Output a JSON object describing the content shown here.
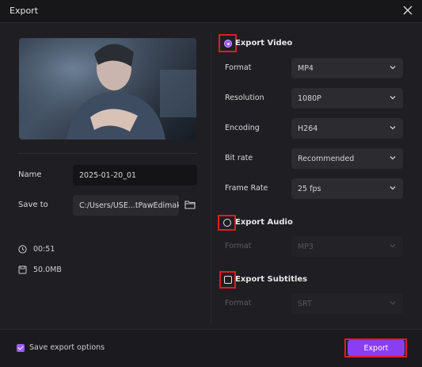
{
  "window": {
    "title": "Export"
  },
  "left": {
    "name_label": "Name",
    "name_value": "2025-01-20_01",
    "saveto_label": "Save to",
    "saveto_value": "C:/Users/USE...tPawEdimakor",
    "duration": "00:51",
    "size": "50.0MB"
  },
  "video": {
    "section_label": "Export Video",
    "enabled": true,
    "rows": [
      {
        "label": "Format",
        "value": "MP4"
      },
      {
        "label": "Resolution",
        "value": "1080P"
      },
      {
        "label": "Encoding",
        "value": "H264"
      },
      {
        "label": "Bit rate",
        "value": "Recommended"
      },
      {
        "label": "Frame Rate",
        "value": "25  fps"
      }
    ]
  },
  "audio": {
    "section_label": "Export Audio",
    "enabled": false,
    "format_label": "Format",
    "format_value": "MP3"
  },
  "subtitles": {
    "section_label": "Export Subtitles",
    "enabled": false,
    "format_label": "Format",
    "format_value": "SRT"
  },
  "footer": {
    "save_options_label": "Save export options",
    "save_options_checked": true,
    "export_label": "Export"
  },
  "colors": {
    "accent": "#8b3df2",
    "highlight": "#e01b24"
  }
}
